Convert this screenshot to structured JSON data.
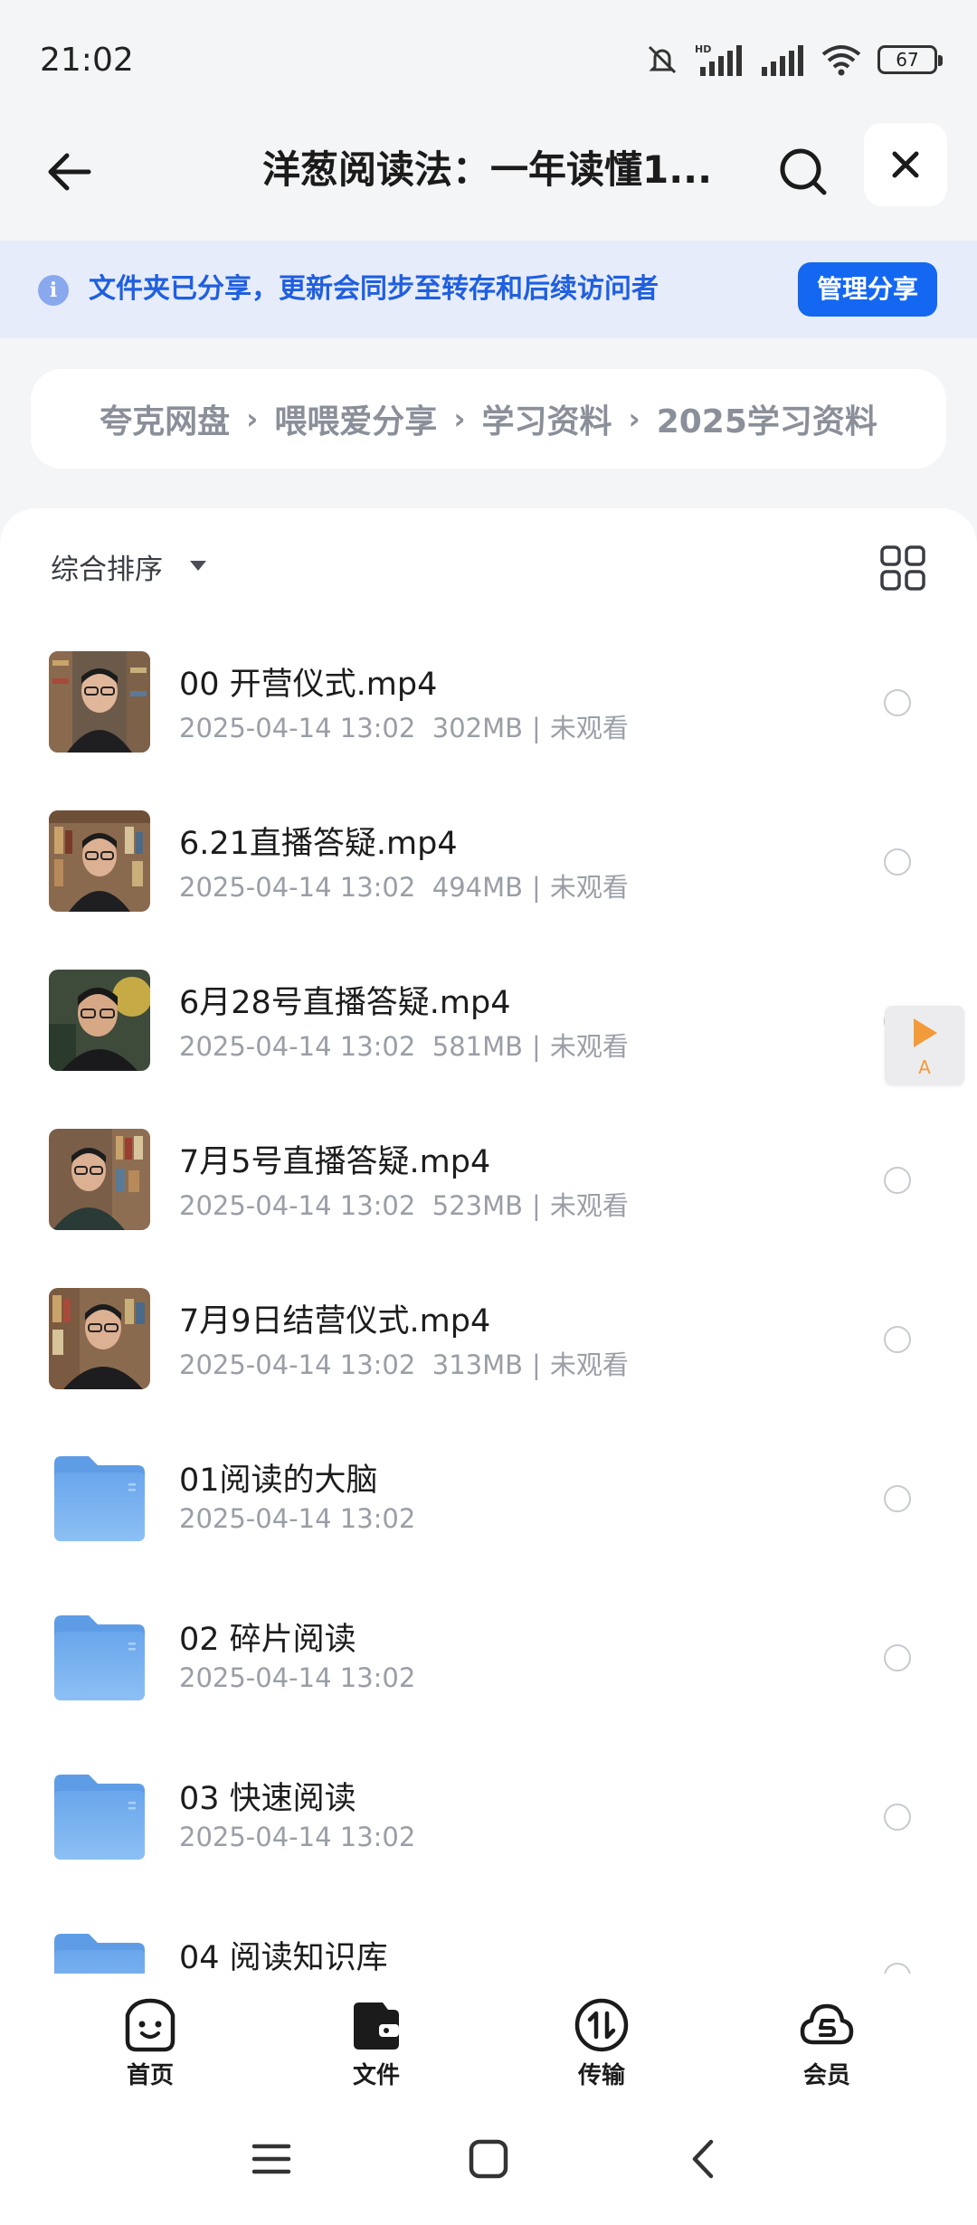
{
  "status_bar": {
    "time": "21:02",
    "battery": "67",
    "network_label": "HD"
  },
  "header": {
    "title": "洋葱阅读法：一年读懂1..."
  },
  "share_banner": {
    "text": "文件夹已分享，更新会同步至转存和后续访问者",
    "button_label": "管理分享"
  },
  "breadcrumb": {
    "items": [
      "夸克网盘",
      "喂喂爱分享",
      "学习资料",
      "2025学习资料"
    ]
  },
  "toolbar": {
    "sort_label": "综合排序"
  },
  "files": [
    {
      "name": "00 开营仪式.mp4",
      "date": "2025-04-14 13:02",
      "size": "302MB",
      "status": "未观看",
      "kind": "video"
    },
    {
      "name": "6.21直播答疑.mp4",
      "date": "2025-04-14 13:02",
      "size": "494MB",
      "status": "未观看",
      "kind": "video"
    },
    {
      "name": "6月28号直播答疑.mp4",
      "date": "2025-04-14 13:02",
      "size": "581MB",
      "status": "未观看",
      "kind": "video"
    },
    {
      "name": "7月5号直播答疑.mp4",
      "date": "2025-04-14 13:02",
      "size": "523MB",
      "status": "未观看",
      "kind": "video"
    },
    {
      "name": "7月9日结营仪式.mp4",
      "date": "2025-04-14 13:02",
      "size": "313MB",
      "status": "未观看",
      "kind": "video"
    },
    {
      "name": "01阅读的大脑",
      "date": "2025-04-14 13:02",
      "kind": "folder"
    },
    {
      "name": "02 碎片阅读",
      "date": "2025-04-14 13:02",
      "kind": "folder"
    },
    {
      "name": "03 快速阅读",
      "date": "2025-04-14 13:02",
      "kind": "folder"
    },
    {
      "name": "04 阅读知识库",
      "kind": "folder"
    }
  ],
  "float_player": {
    "label": "A"
  },
  "bottom_nav": {
    "items": [
      {
        "label": "首页",
        "icon": "smiley-home-icon"
      },
      {
        "label": "文件",
        "icon": "wallet-folder-icon"
      },
      {
        "label": "传输",
        "icon": "transfer-icon"
      },
      {
        "label": "会员",
        "icon": "member-cloud-icon"
      }
    ]
  },
  "colors": {
    "accent": "#1467f0",
    "banner_bg": "#e6ecf9",
    "banner_text": "#1f5fe0",
    "page_bg": "#f4f5f7",
    "folder": "#7fb4f0"
  }
}
